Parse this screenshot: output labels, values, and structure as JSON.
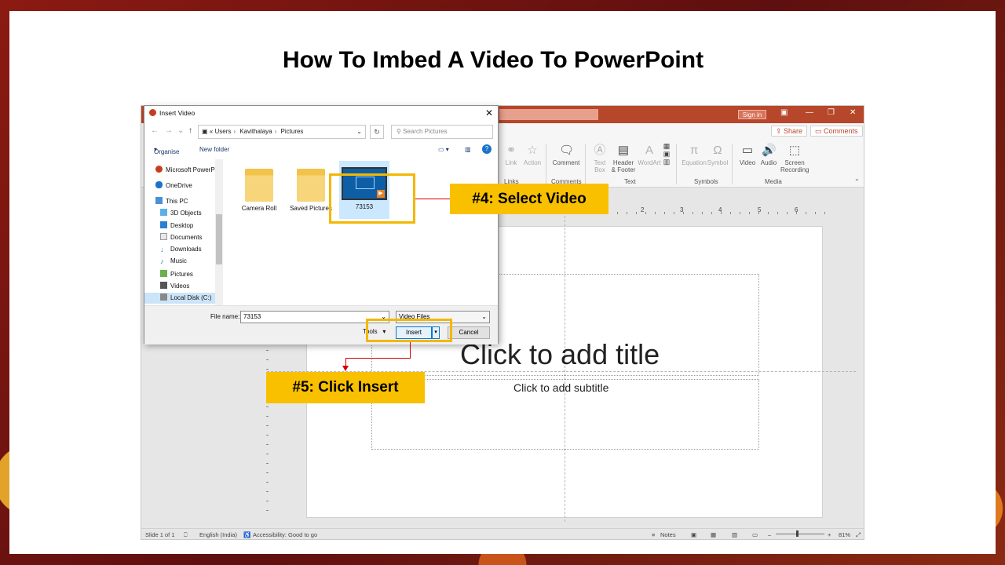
{
  "slide": {
    "title": "How To Imbed A Video To PowerPoint"
  },
  "ppt": {
    "signin": "Sign in",
    "share": "Share",
    "comments": "Comments",
    "ribbon": {
      "link": "Link",
      "action": "Action",
      "group_links": "Links",
      "comment": "Comment",
      "group_comments": "Comments",
      "textbox_l1": "Text",
      "textbox_l2": "Box",
      "header_l1": "Header",
      "header_l2": "& Footer",
      "wordart": "WordArt",
      "group_text": "Text",
      "equation": "Equation",
      "symbol": "Symbol",
      "group_symbols": "Symbols",
      "video": "Video",
      "audio": "Audio",
      "screen_l1": "Screen",
      "screen_l2": "Recording",
      "group_media": "Media"
    },
    "ruler_marks": [
      "2",
      "3",
      "4",
      "5",
      "6"
    ],
    "title_placeholder": "Click to add title",
    "subtitle_placeholder": "Click to add subtitle",
    "status": {
      "slide": "Slide 1 of 1",
      "language": "English (India)",
      "accessibility": "Accessibility: Good to go",
      "notes": "Notes",
      "zoom": "81%"
    }
  },
  "dialog": {
    "title": "Insert Video",
    "path": [
      "Users",
      "Kavithalaya",
      "Pictures"
    ],
    "search_placeholder": "Search Pictures",
    "organise": "Organise",
    "new_folder": "New folder",
    "nav_items": [
      "Microsoft PowerP",
      "OneDrive",
      "This PC",
      "3D Objects",
      "Desktop",
      "Documents",
      "Downloads",
      "Music",
      "Pictures",
      "Videos",
      "Local Disk (C:)"
    ],
    "files": [
      "Camera Roll",
      "Saved Pictures",
      "73153"
    ],
    "file_name_label": "File name:",
    "file_name_value": "73153",
    "file_type": "Video Files",
    "tools": "Tools",
    "insert": "Insert",
    "cancel": "Cancel"
  },
  "callouts": {
    "step4": "#4: Select Video",
    "step5": "#5: Click Insert"
  },
  "colors": {
    "accent_callout": "#f9c000",
    "ppt_brand": "#b7472a",
    "arrow": "#d00000"
  }
}
